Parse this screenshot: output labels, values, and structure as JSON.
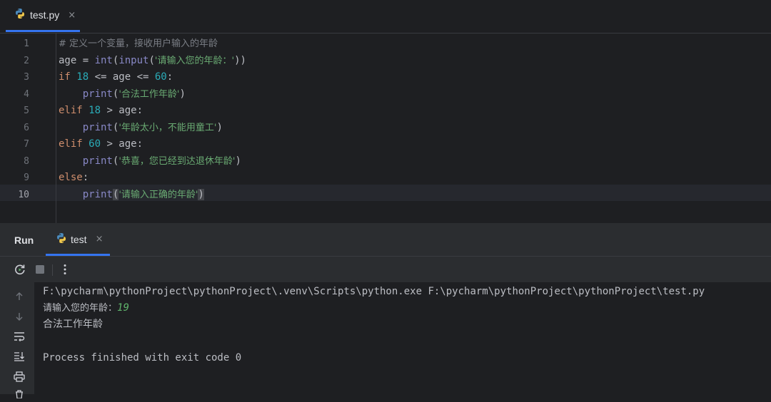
{
  "editor": {
    "tab": {
      "file_name": "test.py",
      "close": "×",
      "icon": "python-file-icon"
    },
    "line_numbers": [
      "1",
      "2",
      "3",
      "4",
      "5",
      "6",
      "7",
      "8",
      "9",
      "10"
    ],
    "current_line": "10",
    "lines": [
      [
        {
          "t": "# 定义一个变量，接收用户输入的年龄",
          "c": "cm"
        }
      ],
      [
        {
          "t": "age = ",
          "c": ""
        },
        {
          "t": "int",
          "c": "fn"
        },
        {
          "t": "(",
          "c": ""
        },
        {
          "t": "input",
          "c": "fn"
        },
        {
          "t": "(",
          "c": ""
        },
        {
          "t": "'请输入您的年龄：'",
          "c": "str"
        },
        {
          "t": "))",
          "c": ""
        }
      ],
      [
        {
          "t": "if ",
          "c": "kw"
        },
        {
          "t": "18",
          "c": "num"
        },
        {
          "t": " <= age <= ",
          "c": ""
        },
        {
          "t": "60",
          "c": "num"
        },
        {
          "t": ":",
          "c": ""
        }
      ],
      [
        {
          "t": "    ",
          "c": ""
        },
        {
          "t": "print",
          "c": "fn"
        },
        {
          "t": "(",
          "c": ""
        },
        {
          "t": "'合法工作年龄'",
          "c": "str"
        },
        {
          "t": ")",
          "c": ""
        }
      ],
      [
        {
          "t": "elif ",
          "c": "kw"
        },
        {
          "t": "18",
          "c": "num"
        },
        {
          "t": " > age:",
          "c": ""
        }
      ],
      [
        {
          "t": "    ",
          "c": ""
        },
        {
          "t": "print",
          "c": "fn"
        },
        {
          "t": "(",
          "c": ""
        },
        {
          "t": "'年龄太小，不能用童工'",
          "c": "str"
        },
        {
          "t": ")",
          "c": ""
        }
      ],
      [
        {
          "t": "elif ",
          "c": "kw"
        },
        {
          "t": "60",
          "c": "num"
        },
        {
          "t": " > age:",
          "c": ""
        }
      ],
      [
        {
          "t": "    ",
          "c": ""
        },
        {
          "t": "print",
          "c": "fn"
        },
        {
          "t": "(",
          "c": ""
        },
        {
          "t": "'恭喜，您已经到达退休年龄'",
          "c": "str"
        },
        {
          "t": ")",
          "c": ""
        }
      ],
      [
        {
          "t": "else",
          "c": "kw"
        },
        {
          "t": ":",
          "c": ""
        }
      ],
      [
        {
          "t": "    ",
          "c": ""
        },
        {
          "t": "print",
          "c": "fn"
        },
        {
          "t": "(",
          "c": "brk"
        },
        {
          "t": "'请输入正确的年龄'",
          "c": "str"
        },
        {
          "t": ")",
          "c": "brk"
        }
      ]
    ]
  },
  "run_panel": {
    "title": "Run",
    "tab": {
      "label": "test",
      "close": "×",
      "icon": "python-file-icon"
    },
    "toolbar": [
      "rerun-icon",
      "stop-icon",
      "more-options-icon"
    ],
    "sidebar": [
      "scroll-up-icon",
      "scroll-down-icon",
      "soft-wrap-icon",
      "scroll-to-end-icon",
      "print-icon",
      "clear-icon"
    ],
    "console": {
      "command": "F:\\pycharm\\pythonProject\\pythonProject\\.venv\\Scripts\\python.exe F:\\pycharm\\pythonProject\\pythonProject\\test.py",
      "prompt": "请输入您的年龄：",
      "user_input": "19",
      "output": "合法工作年龄",
      "exit_message": "Process finished with exit code 0"
    }
  },
  "colors": {
    "editor_bg": "#1e1f22",
    "panel_bg": "#2b2d30",
    "accent": "#3574f0",
    "keyword": "#cf8e6d",
    "number": "#2aacb8",
    "string": "#6aab73",
    "builtin": "#8888c6",
    "comment": "#7a7e85",
    "user_input": "#5fb36b"
  }
}
